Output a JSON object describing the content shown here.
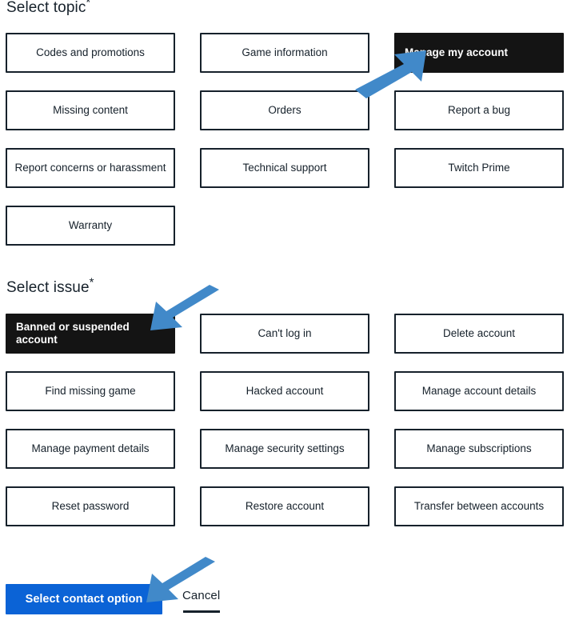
{
  "page": {
    "background_color": "#ffffff",
    "text_color": "#16212b"
  },
  "topic_section": {
    "heading": "Select topic",
    "required_marker": "*",
    "selected": "Manage my account",
    "options": [
      "Codes and promotions",
      "Game information",
      "Manage my account",
      "Missing content",
      "Orders",
      "Report a bug",
      "Report concerns or harassment",
      "Technical support",
      "Twitch Prime",
      "Warranty"
    ]
  },
  "issue_section": {
    "heading": "Select issue",
    "required_marker": "*",
    "selected": "Banned or suspended account",
    "options": [
      "Banned or suspended account",
      "Can't log in",
      "Delete account",
      "Find missing game",
      "Hacked account",
      "Manage account details",
      "Manage payment details",
      "Manage security settings",
      "Manage subscriptions",
      "Reset password",
      "Restore account",
      "Transfer between accounts"
    ]
  },
  "footer": {
    "primary_label": "Select contact option",
    "cancel_label": "Cancel",
    "primary_color": "#0b63d6"
  },
  "annotations": {
    "arrow_color": "#4189c9",
    "arrows": [
      {
        "name": "arrow-to-manage-my-account",
        "target": "Manage my account",
        "direction": "up-right"
      },
      {
        "name": "arrow-to-banned-or-suspended-account",
        "target": "Banned or suspended account",
        "direction": "down-left"
      },
      {
        "name": "arrow-to-select-contact-option",
        "target": "Select contact option",
        "direction": "down-left"
      }
    ]
  }
}
